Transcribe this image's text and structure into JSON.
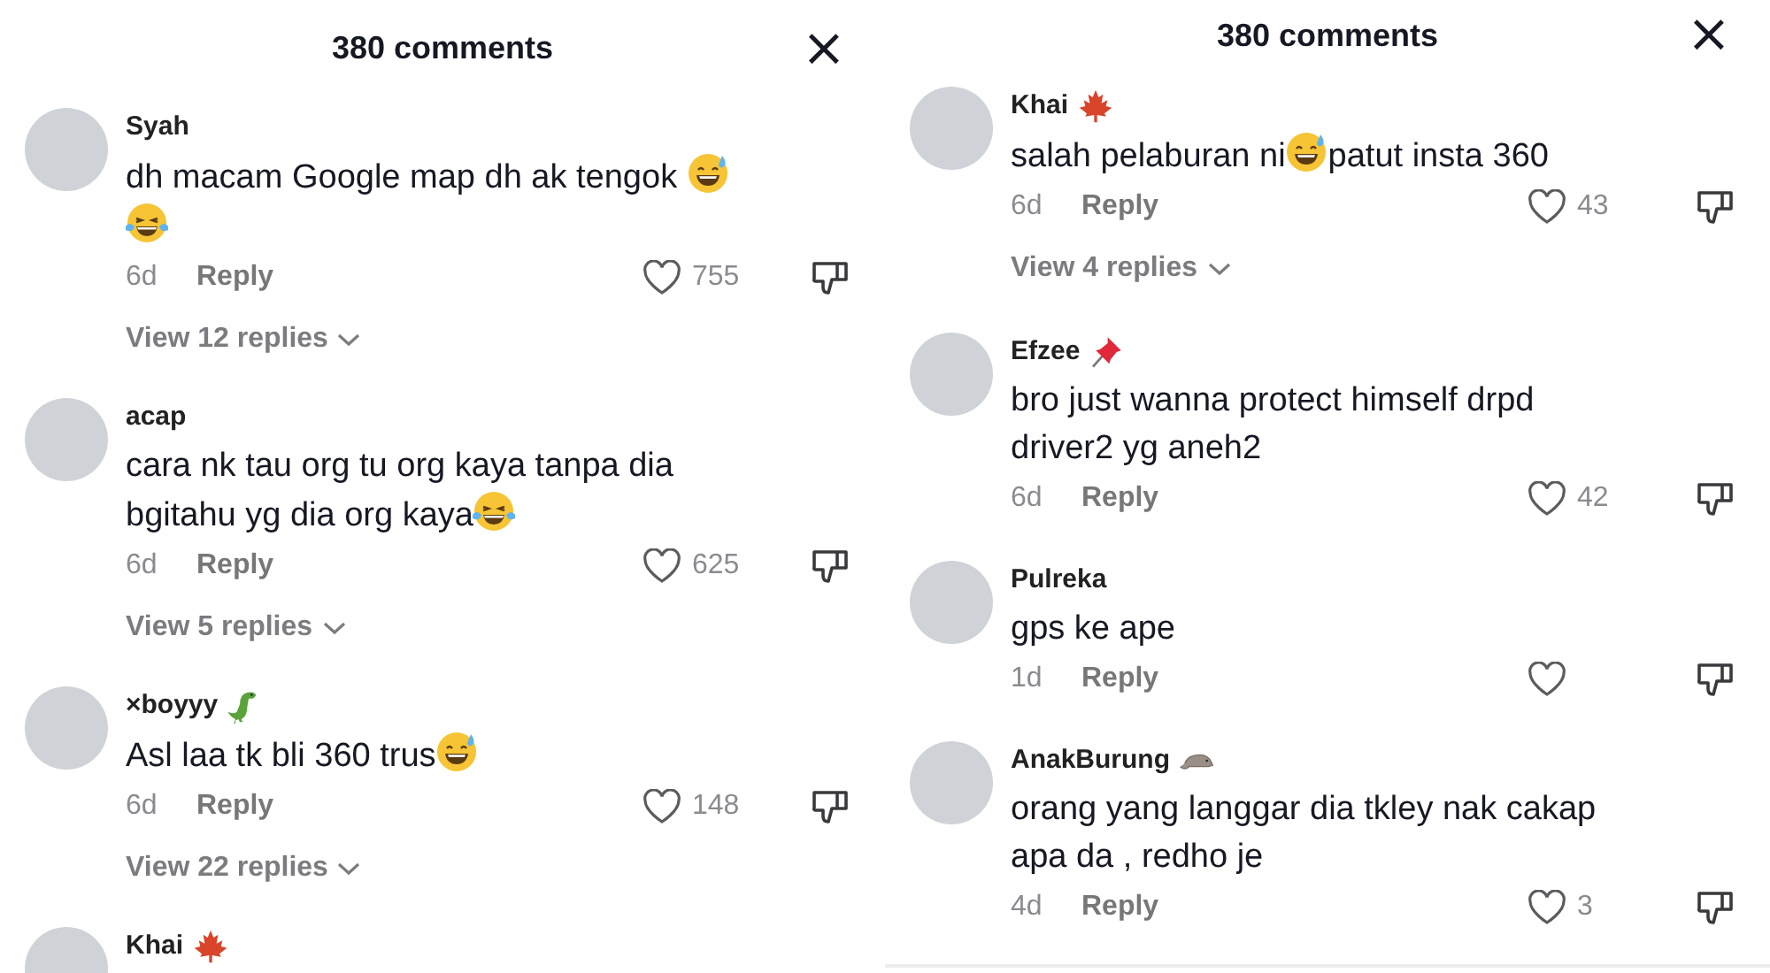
{
  "panels": [
    {
      "title": "380 comments",
      "close": "×",
      "comments": [
        {
          "name": "Syah",
          "lines": [
            [
              {
                "kind": "text",
                "text": "dh macam Google map dh ak tengok "
              },
              {
                "kind": "grin"
              }
            ],
            [
              {
                "kind": "joy"
              }
            ]
          ],
          "age": "6d",
          "reply": "Reply",
          "likes": "755",
          "view_replies": "View 12 replies"
        },
        {
          "name": "acap",
          "lines": [
            [
              {
                "kind": "text",
                "text": "cara nk tau org tu org kaya tanpa dia"
              }
            ],
            [
              {
                "kind": "text",
                "text": "bgitahu yg dia org kaya"
              },
              {
                "kind": "joy"
              }
            ]
          ],
          "age": "6d",
          "reply": "Reply",
          "likes": "625",
          "view_replies": "View 5 replies"
        },
        {
          "name": "×boyyy",
          "badge": {
            "kind": "dino"
          },
          "lines": [
            [
              {
                "kind": "text",
                "text": "Asl laa tk bli 360 trus"
              },
              {
                "kind": "grin"
              }
            ]
          ],
          "age": "6d",
          "reply": "Reply",
          "likes": "148",
          "view_replies": "View 22 replies"
        },
        {
          "name": "Khai",
          "badge": {
            "kind": "maple"
          }
        }
      ]
    },
    {
      "title": "380 comments",
      "close": "×",
      "comments": [
        {
          "name": "Khai",
          "badge": {
            "kind": "maple"
          },
          "lines": [
            [
              {
                "kind": "text",
                "text": "salah pelaburan ni"
              },
              {
                "kind": "grin"
              },
              {
                "kind": "text",
                "text": "patut insta 360"
              }
            ]
          ],
          "age": "6d",
          "reply": "Reply",
          "likes": "43",
          "view_replies": "View 4 replies"
        },
        {
          "name": "Efzee",
          "badge": {
            "kind": "pin"
          },
          "lines": [
            [
              {
                "kind": "text",
                "text": "bro just wanna protect himself drpd"
              }
            ],
            [
              {
                "kind": "text",
                "text": "driver2 yg aneh2"
              }
            ]
          ],
          "age": "6d",
          "reply": "Reply",
          "likes": "42"
        },
        {
          "name": "Pulreka",
          "lines": [
            [
              {
                "kind": "text",
                "text": "gps ke ape"
              }
            ]
          ],
          "age": "1d",
          "reply": "Reply"
        },
        {
          "name": "AnakBurung",
          "badge": {
            "kind": "rat"
          },
          "lines": [
            [
              {
                "kind": "text",
                "text": "orang yang langgar dia tkley nak cakap"
              }
            ],
            [
              {
                "kind": "text",
                "text": "apa da , redho je"
              }
            ]
          ],
          "age": "4d",
          "reply": "Reply",
          "likes": "3"
        }
      ]
    }
  ]
}
